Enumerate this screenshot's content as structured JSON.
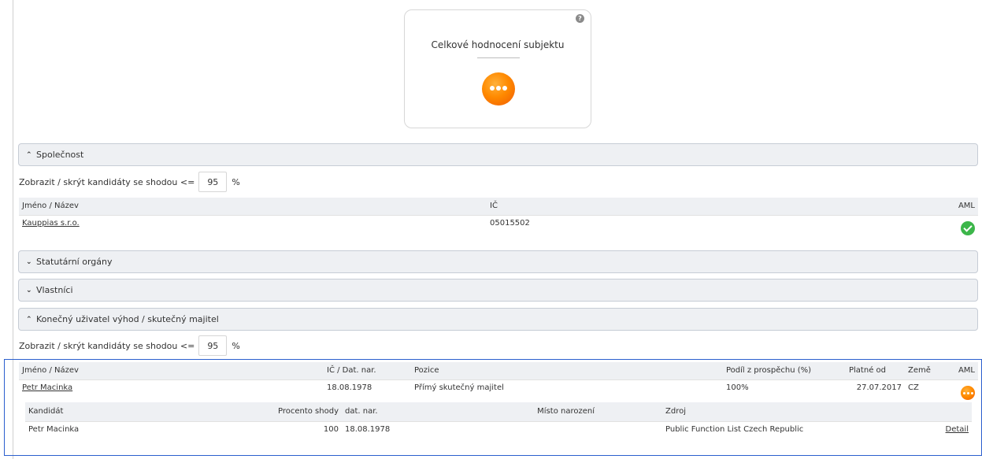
{
  "score_card": {
    "title": "Celkové hodnocení subjektu",
    "help_icon": "question-circle-icon",
    "status_icon": "pending-dots-icon",
    "status_color": "#ff8a00"
  },
  "company_section": {
    "header": "Společnost",
    "expanded": true,
    "filter": {
      "label": "Zobrazit / skrýt kandidáty se shodou <=",
      "value": "95",
      "unit": "%"
    },
    "columns": [
      "Jméno / Název",
      "IČ",
      "AML"
    ],
    "rows": [
      {
        "name": "Kauppias s.r.o.",
        "ic": "05015502",
        "aml_icon": "check-circle-icon",
        "aml_color": "#3cb64a"
      }
    ]
  },
  "statutory_section": {
    "header": "Statutární orgány",
    "expanded": false
  },
  "owners_section": {
    "header": "Vlastníci",
    "expanded": false
  },
  "ubo_section": {
    "header": "Konečný uživatel výhod / skutečný majitel",
    "expanded": true,
    "filter": {
      "label": "Zobrazit / skrýt kandidáty se shodou <=",
      "value": "95",
      "unit": "%"
    },
    "columns": [
      "Jméno / Název",
      "IČ / Dat. nar.",
      "Pozice",
      "Podíl z prospěchu (%)",
      "Platné od",
      "Země",
      "AML"
    ],
    "rows": [
      {
        "name": "Petr Macinka",
        "ic_date": "18.08.1978",
        "position": "Přímý skutečný majitel",
        "share": "100%",
        "valid_from": "27.07.2017",
        "country": "CZ",
        "aml_icon": "pending-dots-icon",
        "aml_color": "#ff8a00"
      }
    ],
    "candidates": {
      "columns": [
        "Kandidát",
        "Procento shody",
        "dat. nar.",
        "Místo narození",
        "Zdroj"
      ],
      "rows": [
        {
          "candidate": "Petr Macinka",
          "match": "100",
          "birth_date": "18.08.1978",
          "birth_place": "",
          "source": "Public Function List Czech Republic",
          "detail": "Detail"
        }
      ]
    }
  }
}
